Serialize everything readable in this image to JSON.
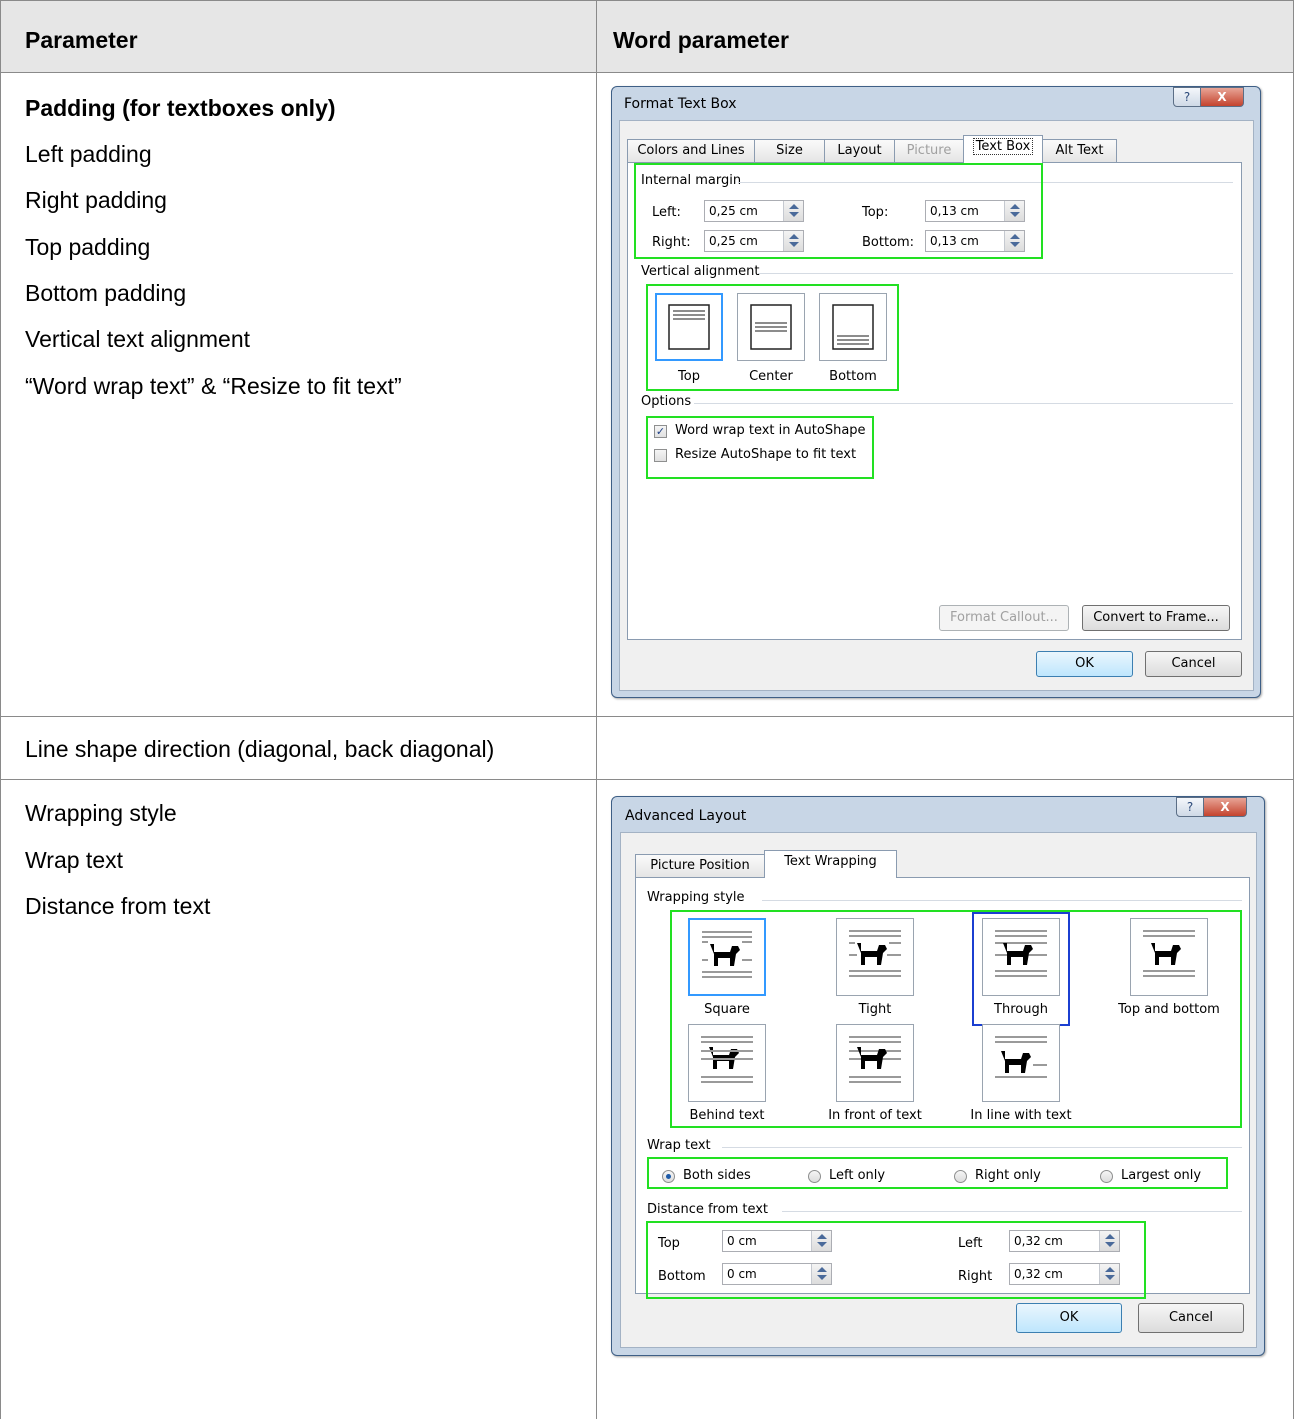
{
  "table": {
    "headers": [
      "Parameter",
      "Word parameter"
    ],
    "rows": [
      {
        "params": [
          "Padding (for textboxes only)",
          "Left padding",
          "Right padding",
          "Top padding",
          "Bottom padding",
          "Vertical text alignment",
          "“Word wrap text” & “Resize to fit text”"
        ]
      },
      {
        "params": [
          "Line shape direction (diagonal, back diagonal)"
        ]
      },
      {
        "params": [
          "Wrapping style",
          "Wrap text",
          "Distance from text"
        ]
      }
    ]
  },
  "dialog1": {
    "title": "Format Text Box",
    "help": "?",
    "close": "X",
    "tabs": [
      "Colors and Lines",
      "Size",
      "Layout",
      "Picture",
      "Text Box",
      "Alt Text"
    ],
    "internal_margin": {
      "label": "Internal margin",
      "left_label": "Left:",
      "left_value": "0,25 cm",
      "right_label": "Right:",
      "right_value": "0,25 cm",
      "top_label": "Top:",
      "top_value": "0,13 cm",
      "bottom_label": "Bottom:",
      "bottom_value": "0,13 cm"
    },
    "vertical_alignment": {
      "label": "Vertical alignment",
      "options": [
        "Top",
        "Center",
        "Bottom"
      ],
      "selected": "Top"
    },
    "options": {
      "label": "Options",
      "word_wrap": "Word wrap text in AutoShape",
      "word_wrap_checked": true,
      "resize": "Resize AutoShape to fit text",
      "resize_checked": false
    },
    "format_callout": "Format Callout...",
    "convert_to_frame": "Convert to Frame...",
    "ok": "OK",
    "cancel": "Cancel"
  },
  "dialog2": {
    "title": "Advanced Layout",
    "help": "?",
    "close": "X",
    "tabs": [
      "Picture Position",
      "Text Wrapping"
    ],
    "wrapping_style": {
      "label": "Wrapping style",
      "options": [
        "Square",
        "Tight",
        "Through",
        "Top and bottom",
        "Behind text",
        "In front of text",
        "In line with text"
      ],
      "selected": "Through"
    },
    "wrap_text": {
      "label": "Wrap text",
      "options": [
        "Both sides",
        "Left only",
        "Right only",
        "Largest only"
      ],
      "selected": "Both sides"
    },
    "distance": {
      "label": "Distance from text",
      "top_label": "Top",
      "top_value": "0 cm",
      "bottom_label": "Bottom",
      "bottom_value": "0 cm",
      "left_label": "Left",
      "left_value": "0,32 cm",
      "right_label": "Right",
      "right_value": "0,32 cm"
    },
    "ok": "OK",
    "cancel": "Cancel"
  },
  "colors": {
    "highlight": "#22e022",
    "selection_blue": "#1b3fd1",
    "header_bg": "#e6e6e6"
  }
}
